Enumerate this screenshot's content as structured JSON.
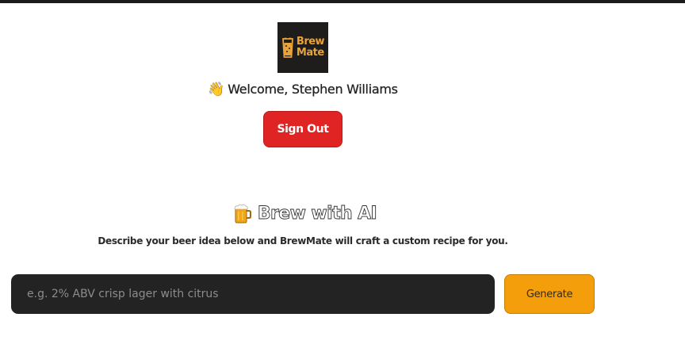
{
  "header": {
    "logo_line1": "Brew",
    "logo_line2": "Mate",
    "logo_icon": "beer-glass-icon",
    "welcome_emoji": "👋",
    "welcome_text": "Welcome, Stephen Williams",
    "signout_label": "Sign Out"
  },
  "brew": {
    "title_icon": "beer-mug-icon",
    "title": "Brew with AI",
    "subtitle": "Describe your beer idea below and BrewMate will craft a custom recipe for you.",
    "input_value": "",
    "input_placeholder": "e.g. 2% ABV crisp lager with citrus",
    "generate_label": "Generate"
  },
  "colors": {
    "accent": "#f59e0b",
    "danger": "#e02424",
    "input_bg": "#232323",
    "logo_text": "#e8a33a"
  }
}
